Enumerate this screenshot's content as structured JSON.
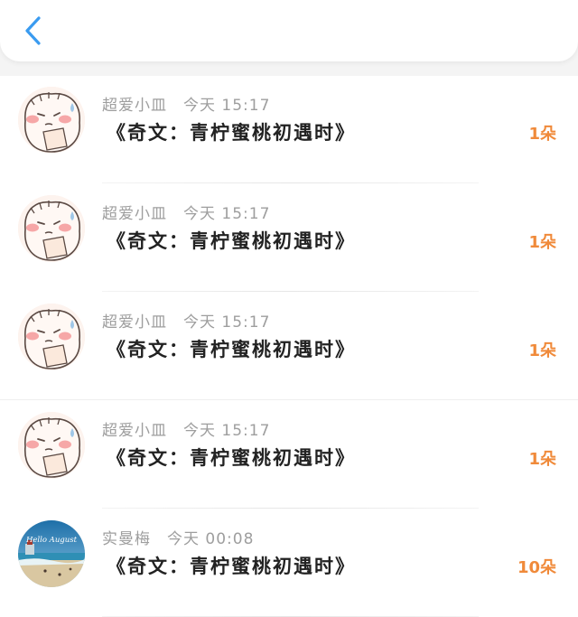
{
  "header": {
    "back_icon": "chevron-left-icon",
    "accent": "#3a9bf0"
  },
  "colors": {
    "amount": "#f08a3a",
    "title": "#222222",
    "meta": "#9e9e9e"
  },
  "items": [
    {
      "user": "超爱小皿",
      "time": "今天 15:17",
      "title": "《奇文：青柠蜜桃初遇时》",
      "amount": "1朵",
      "avatar": "cartoon-face-avatar"
    },
    {
      "user": "超爱小皿",
      "time": "今天 15:17",
      "title": "《奇文：青柠蜜桃初遇时》",
      "amount": "1朵",
      "avatar": "cartoon-face-avatar"
    },
    {
      "user": "超爱小皿",
      "time": "今天 15:17",
      "title": "《奇文：青柠蜜桃初遇时》",
      "amount": "1朵",
      "avatar": "cartoon-face-avatar"
    },
    {
      "user": "超爱小皿",
      "time": "今天 15:17",
      "title": "《奇文：青柠蜜桃初遇时》",
      "amount": "1朵",
      "avatar": "cartoon-face-avatar"
    },
    {
      "user": "实曼梅",
      "time": "今天 00:08",
      "title": "《奇文：青柠蜜桃初遇时》",
      "amount": "10朵",
      "avatar": "beach-photo-avatar",
      "avatar_text": "Hello August"
    }
  ]
}
